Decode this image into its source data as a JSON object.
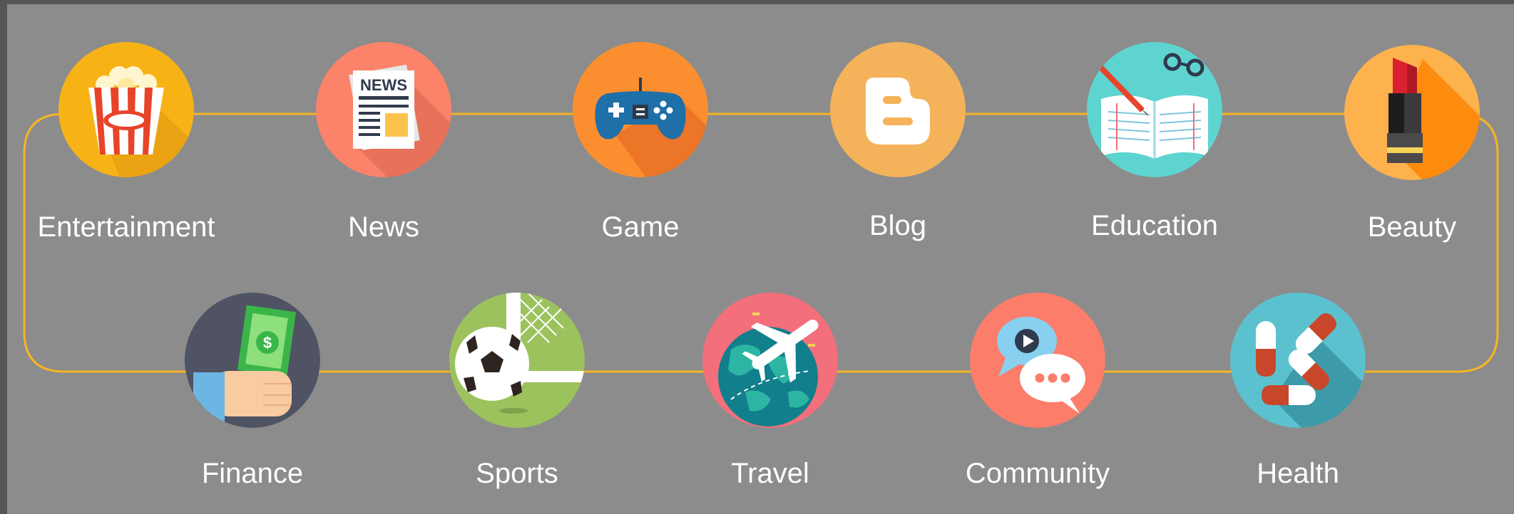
{
  "categories": {
    "row1": [
      {
        "label": "Entertainment",
        "icon": "popcorn-icon",
        "color": "#f7b316"
      },
      {
        "label": "News",
        "icon": "newspaper-icon",
        "color": "#fa836a"
      },
      {
        "label": "Game",
        "icon": "gamepad-icon",
        "color": "#fb8f2f"
      },
      {
        "label": "Blog",
        "icon": "blogger-icon",
        "color": "#f4b35a"
      },
      {
        "label": "Education",
        "icon": "open-book-icon",
        "color": "#5ed4d0"
      },
      {
        "label": "Beauty",
        "icon": "lipstick-icon",
        "color": "#fdb24d"
      }
    ],
    "row2": [
      {
        "label": "Finance",
        "icon": "money-hand-icon",
        "color": "#4f5363"
      },
      {
        "label": "Sports",
        "icon": "soccer-ball-icon",
        "color": "#9cc25e"
      },
      {
        "label": "Travel",
        "icon": "airplane-globe-icon",
        "color": "#f36f7c"
      },
      {
        "label": "Community",
        "icon": "chat-bubbles-icon",
        "color": "#fb7d6a"
      },
      {
        "label": "Health",
        "icon": "pills-icon",
        "color": "#5bc1cf"
      }
    ]
  },
  "connector_color": "#f5b524",
  "background_color": "#8c8c8c"
}
